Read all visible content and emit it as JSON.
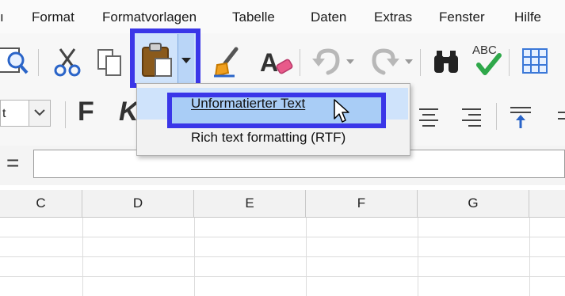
{
  "menubar": {
    "partial_left": "ı",
    "items": [
      {
        "label": "Format"
      },
      {
        "label": "Formatvorlagen"
      },
      {
        "label": "Tabelle"
      },
      {
        "label": "Daten"
      },
      {
        "label": "Extras"
      },
      {
        "label": "Fenster"
      },
      {
        "label": "Hilfe"
      }
    ]
  },
  "toolbar1": {
    "icons": [
      "print-preview-icon",
      "cut-icon",
      "copy-icon",
      "paste-icon",
      "paste-dropdown-arrow-icon",
      "clone-formatting-icon",
      "clear-formatting-icon",
      "undo-icon",
      "undo-dropdown-icon",
      "redo-icon",
      "redo-dropdown-icon",
      "find-replace-icon",
      "spellcheck-icon",
      "spellcheck-label",
      "grid-icon"
    ],
    "spell_label": "ABC"
  },
  "toolbar2": {
    "font_size_partial": "t",
    "bold_label": "F",
    "italic_label": "K",
    "icons": [
      "align-center-icon",
      "align-right-icon",
      "align-top-icon"
    ]
  },
  "formula": {
    "symbol": "="
  },
  "grid": {
    "columns": [
      "C",
      "D",
      "E",
      "F",
      "G"
    ]
  },
  "dropdown": {
    "items": [
      {
        "label": "Unformatierter Text"
      },
      {
        "label": "Rich text formatting (RTF)"
      }
    ]
  },
  "colors": {
    "highlight_border": "#3a36e8",
    "highlight_fill": "#a9cdf6"
  }
}
